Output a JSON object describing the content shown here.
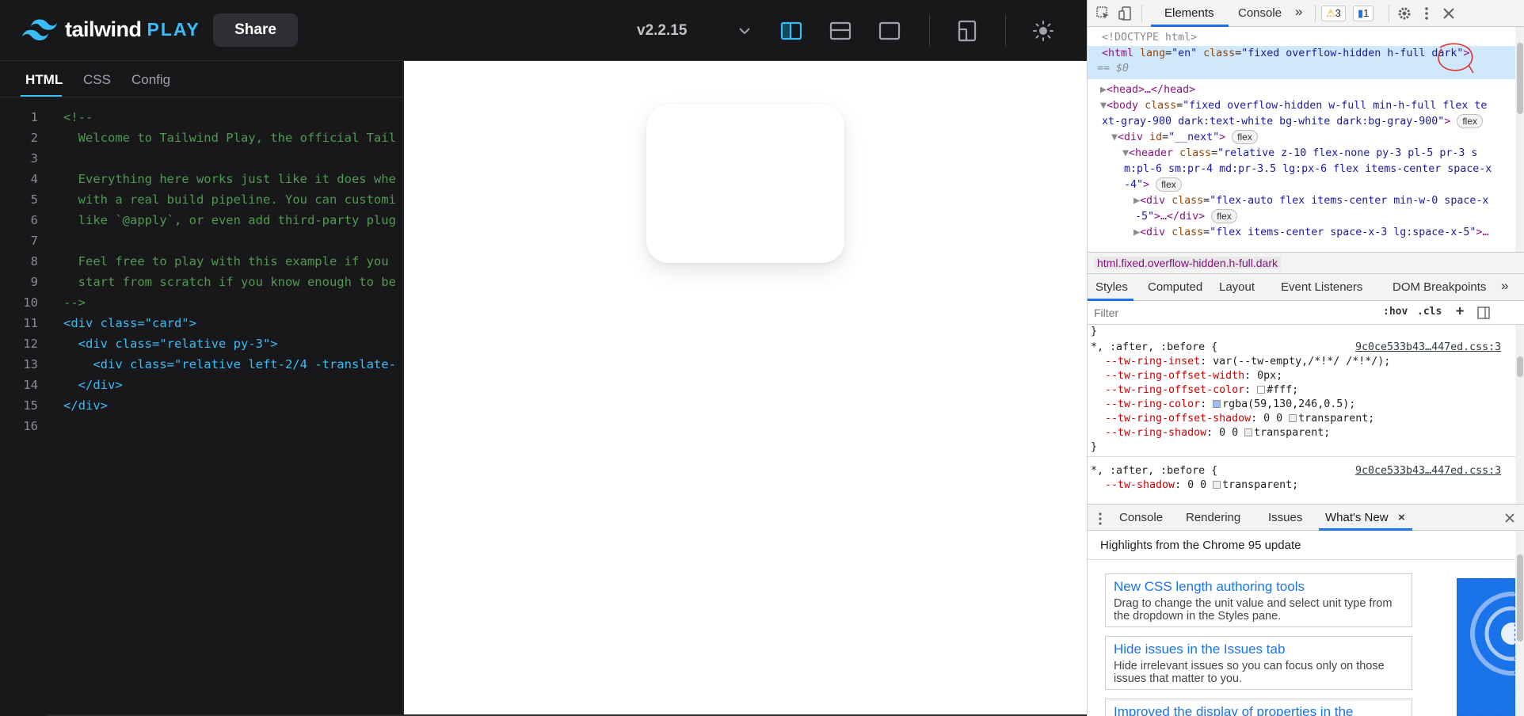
{
  "play": {
    "logo_word": "tailwind",
    "logo_play": "PLAY",
    "share_label": "Share",
    "version": "v2.2.15",
    "editor_tabs": [
      "HTML",
      "CSS",
      "Config"
    ],
    "active_tab": "HTML",
    "code_lines": [
      {
        "n": "1",
        "t": "<!--"
      },
      {
        "n": "2",
        "t": "  Welcome to Tailwind Play, the official Tail"
      },
      {
        "n": "3",
        "t": ""
      },
      {
        "n": "4",
        "t": "  Everything here works just like it does whe"
      },
      {
        "n": "5",
        "t": "  with a real build pipeline. You can customi"
      },
      {
        "n": "6",
        "t": "  like `@apply`, or even add third-party plug"
      },
      {
        "n": "7",
        "t": ""
      },
      {
        "n": "8",
        "t": "  Feel free to play with this example if you"
      },
      {
        "n": "9",
        "t": "  start from scratch if you know enough to be"
      },
      {
        "n": "10",
        "t": "-->"
      },
      {
        "n": "11",
        "t": "<div class=\"card\">"
      },
      {
        "n": "12",
        "t": "  <div class=\"relative py-3\">"
      },
      {
        "n": "13",
        "t": "    <div class=\"relative left-2/4 -translate-"
      },
      {
        "n": "14",
        "t": "  </div>"
      },
      {
        "n": "15",
        "t": "</div>"
      },
      {
        "n": "16",
        "t": ""
      }
    ],
    "colors": {
      "bg": "#18181b",
      "accent": "#38bdf8",
      "comment": "#4e9a4e"
    }
  },
  "devtools": {
    "tabs": [
      "Elements",
      "Console"
    ],
    "more_tabs": "»",
    "warning_count": "3",
    "message_count": "1",
    "dom": {
      "doctype": "<!DOCTYPE html>",
      "html_open_tag": "<html",
      "html_lang_attr": "lang",
      "html_lang_val": "\"en\"",
      "html_class_attr": "class",
      "html_class_val": "\"fixed overflow-hidden h-full dark\"",
      "html_close": ">",
      "eq0": "== $0",
      "head": "<head>…</head>",
      "body_open": "<body",
      "body_class_attr": "class",
      "body_class_val_1": "\"fixed overflow-hidden w-full min-h-full flex te",
      "body_class_val_2": "xt-gray-900 dark:text-white bg-white dark:bg-gray-900\"",
      "div_next_open": "<div",
      "div_next_id_attr": "id",
      "div_next_id_val": "\"__next\"",
      "header_open": "<header",
      "header_class_attr": "class",
      "header_class_val_1": "\"relative z-10 flex-none py-3 pl-5 pr-3 s",
      "header_class_val_2": "m:pl-6 sm:pr-4 md:pr-3.5 lg:px-6 flex items-center space-x",
      "header_class_val_3": "-4\"",
      "div1_class_val_1": "\"flex-auto flex items-center min-w-0 space-x",
      "div1_class_val_2": "-5\"",
      "div1_tail": ">…</div>",
      "div2_class_val": "\"flex items-center space-x-3 lg:space-x-5\"",
      "div2_tail": ">…",
      "flex_pill": "flex"
    },
    "breadcrumb": "html.fixed.overflow-hidden.h-full.dark",
    "styles_tabs": [
      "Styles",
      "Computed",
      "Layout",
      "Event Listeners",
      "DOM Breakpoints"
    ],
    "filter_placeholder": "Filter",
    "hov": ":hov",
    "cls": ".cls",
    "rules": {
      "brace_close": "}",
      "selector": "*, :after, :before {",
      "source": "9c0ce533b43…447ed.css:3",
      "props": [
        {
          "name": "--tw-ring-inset",
          "value": "var(--tw-empty,/*!*/ /*!*/);"
        },
        {
          "name": "--tw-ring-offset-width",
          "value": "0px;"
        },
        {
          "name": "--tw-ring-offset-color",
          "value": "#fff;",
          "swatch": "#ffffff"
        },
        {
          "name": "--tw-ring-color",
          "value": "rgba(59,130,246,0.5);",
          "swatch": "#9dbcf5"
        },
        {
          "name": "--tw-ring-offset-shadow",
          "value": "0 0 ",
          "value2": "transparent;",
          "swatch": "#eeeeee"
        },
        {
          "name": "--tw-ring-shadow",
          "value": "0 0 ",
          "value2": "transparent;",
          "swatch": "#eeeeee"
        }
      ],
      "selector2": "*, :after, :before {",
      "source2": "9c0ce533b43…447ed.css:3",
      "prop2_name": "--tw-shadow",
      "prop2_value": "0 0 ",
      "prop2_value2": "transparent;"
    },
    "drawer_tabs": [
      "Console",
      "Rendering",
      "Issues",
      "What's New"
    ],
    "whats_new_header": "Highlights from the Chrome 95 update",
    "whats_new_cards": [
      {
        "title": "New CSS length authoring tools",
        "desc": "Drag to change the unit value and select unit type from the dropdown in the Styles pane."
      },
      {
        "title": "Hide issues in the Issues tab",
        "desc": "Hide irrelevant issues so you can focus only on those issues that matter to you."
      },
      {
        "title": "Improved the display of properties in the",
        "desc": ""
      }
    ],
    "colors": {
      "selection": "#cfe8fc",
      "tab_active": "#1a73e8",
      "tag": "#881280",
      "attr": "#994500",
      "value": "#1a1aa6"
    }
  }
}
